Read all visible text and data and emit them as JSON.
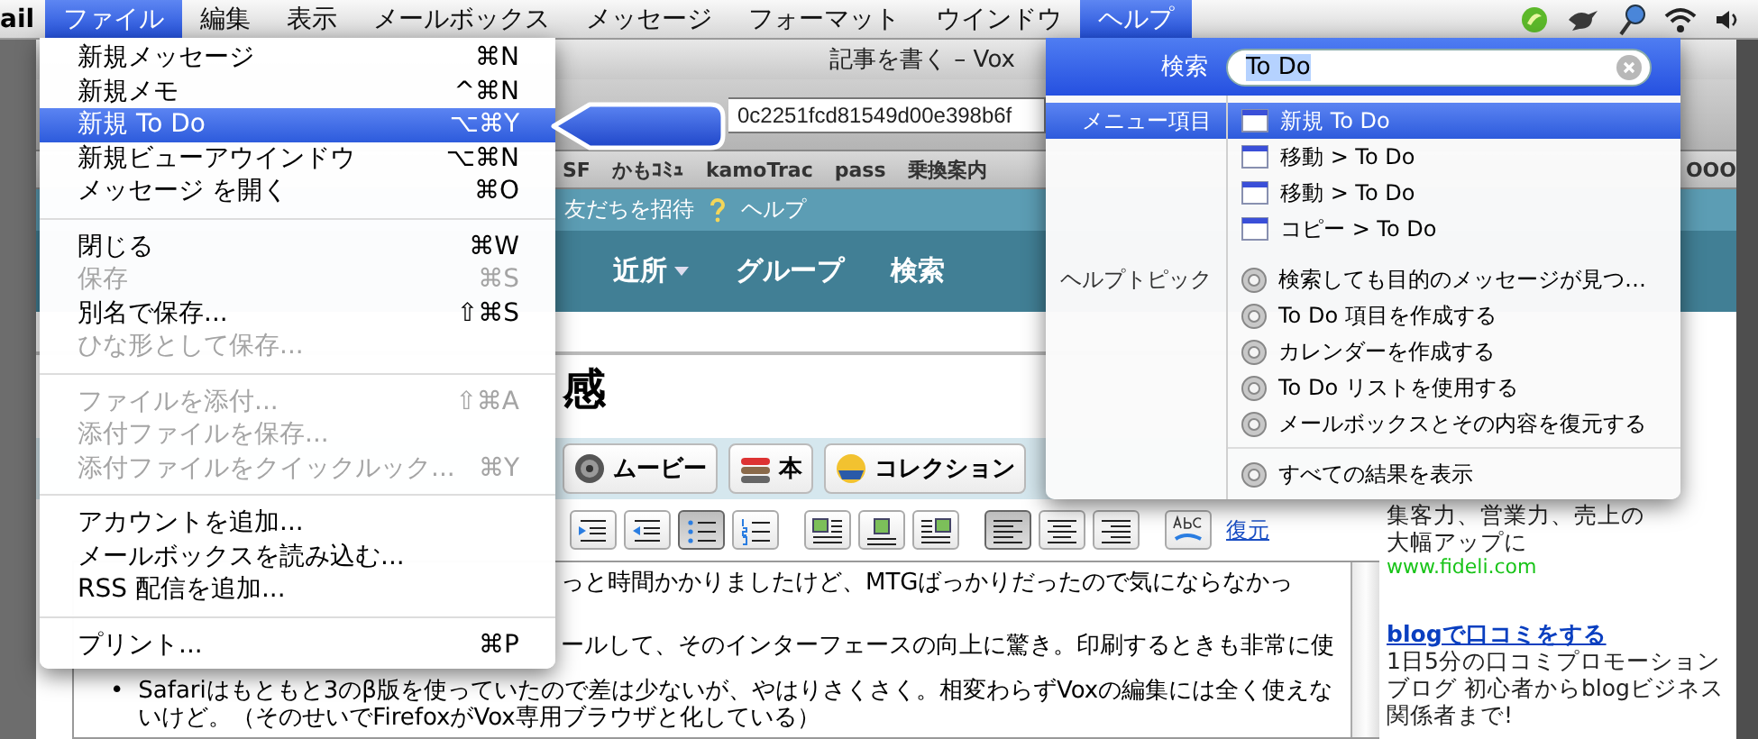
{
  "menubar": {
    "app_name": "ail",
    "menus": [
      {
        "label": "ファイル",
        "selected": true
      },
      {
        "label": "編集",
        "selected": false
      },
      {
        "label": "表示",
        "selected": false
      },
      {
        "label": "メールボックス",
        "selected": false
      },
      {
        "label": "メッセージ",
        "selected": false
      },
      {
        "label": "フォーマット",
        "selected": false
      },
      {
        "label": "ウインドウ",
        "selected": false
      },
      {
        "label": "ヘルプ",
        "selected": true
      }
    ]
  },
  "browser": {
    "title": "記事を書く – Vox",
    "url": "0c2251fcd81549d00e398b6f",
    "bookmarks": [
      "SF",
      "かもｺﾐｭ",
      "kamoTrac",
      "pass",
      "乗換案内"
    ],
    "bookmarks_right": "OOO",
    "site_links": [
      "友だちを招待",
      "ヘルプ"
    ],
    "nav": [
      {
        "label": "近所",
        "dropdown": true
      },
      {
        "label": "グループ",
        "dropdown": false
      },
      {
        "label": "検索",
        "dropdown": false
      }
    ],
    "post_title": "感",
    "insert_buttons": [
      {
        "kind": "movie",
        "label": "ムービー"
      },
      {
        "kind": "book",
        "label": "本"
      },
      {
        "kind": "collection",
        "label": "コレクション"
      }
    ],
    "format_tools": [
      {
        "kind": "indent",
        "on": false
      },
      {
        "kind": "outdent",
        "on": false
      },
      {
        "kind": "bullets",
        "on": true
      },
      {
        "kind": "numbers",
        "on": false
      },
      {
        "kind": "image_left",
        "on": false
      },
      {
        "kind": "image_center",
        "on": false
      },
      {
        "kind": "image_right",
        "on": false
      },
      {
        "kind": "align_left",
        "on": true
      },
      {
        "kind": "align_center",
        "on": false
      },
      {
        "kind": "align_right",
        "on": false
      },
      {
        "kind": "spellcheck"
      }
    ],
    "restore_link": "復元",
    "body": [
      {
        "kind": "paragraph",
        "text": "っと時間かかりましたけど、MTGばっかりだったので気にならなかっ"
      },
      {
        "kind": "paragraph",
        "text": "ールして、そのインターフェースの向上に驚き。印刷するときも非常に使"
      },
      {
        "kind": "bullet",
        "marker": "•",
        "text": "Safariはもともと3のβ版を使っていたので差は少ないが、やはりさくさく。相変わらずVoxの編集には全く使えないけど。（そのせいでFirefoxがVox専用ブラウザと化している）"
      }
    ],
    "sidebar": {
      "ad_lines": [
        "集客力、営業力、売上の",
        "大幅アップに"
      ],
      "ad_url": "www.fideli.com",
      "link": "blogで口コミをする",
      "text": "1日5分の口コミプロモーションブログ 初心者からblogビジネス関係者まで!"
    }
  },
  "file_menu": {
    "items": [
      {
        "kind": "item",
        "label": "新規メッセージ",
        "shortcut": "⌘N",
        "disabled": false,
        "selected": false
      },
      {
        "kind": "item",
        "label": "新規メモ",
        "shortcut": "^⌘N",
        "disabled": false,
        "selected": false
      },
      {
        "kind": "item",
        "label": "新規 To Do",
        "shortcut": "⌥⌘Y",
        "disabled": false,
        "selected": true
      },
      {
        "kind": "item",
        "label": "新規ビューアウインドウ",
        "shortcut": "⌥⌘N",
        "disabled": false,
        "selected": false
      },
      {
        "kind": "item",
        "label": "メッセージ を開く",
        "shortcut": "⌘O",
        "disabled": false,
        "selected": false
      },
      {
        "kind": "separator"
      },
      {
        "kind": "item",
        "label": "閉じる",
        "shortcut": "⌘W",
        "disabled": false,
        "selected": false
      },
      {
        "kind": "item",
        "label": "保存",
        "shortcut": "⌘S",
        "disabled": true,
        "selected": false
      },
      {
        "kind": "item",
        "label": "別名で保存...",
        "shortcut": "⇧⌘S",
        "disabled": false,
        "selected": false
      },
      {
        "kind": "item",
        "label": "ひな形として保存...",
        "disabled": true,
        "selected": false
      },
      {
        "kind": "separator"
      },
      {
        "kind": "item",
        "label": "ファイルを添付...",
        "shortcut": "⇧⌘A",
        "disabled": true,
        "selected": false
      },
      {
        "kind": "item",
        "label": "添付ファイルを保存...",
        "disabled": true,
        "selected": false
      },
      {
        "kind": "item",
        "label": "添付ファイルをクイックルック...",
        "shortcut": "⌘Y",
        "disabled": true,
        "selected": false
      },
      {
        "kind": "separator"
      },
      {
        "kind": "item",
        "label": "アカウントを追加...",
        "disabled": false,
        "selected": false
      },
      {
        "kind": "item",
        "label": "メールボックスを読み込む...",
        "disabled": false,
        "selected": false
      },
      {
        "kind": "item",
        "label": "RSS 配信を追加...",
        "disabled": false,
        "selected": false
      },
      {
        "kind": "separator"
      },
      {
        "kind": "item",
        "label": "プリント...",
        "shortcut": "⌘P",
        "disabled": false,
        "selected": false
      }
    ]
  },
  "help_menu": {
    "search_label": "検索",
    "query": "To Do",
    "sections": [
      {
        "label": "メニュー項目",
        "kind": "menu",
        "results": [
          {
            "label": "新規 To Do",
            "selected": true
          },
          {
            "label": "移動 > To Do",
            "selected": false
          },
          {
            "label": "移動 > To Do",
            "selected": false
          },
          {
            "label": "コピー > To Do",
            "selected": false
          }
        ]
      },
      {
        "label": "ヘルプトピック",
        "kind": "topic",
        "results": [
          {
            "label": "検索しても目的のメッセージが見つ…",
            "selected": false
          },
          {
            "label": "To Do 項目を作成する",
            "selected": false
          },
          {
            "label": "カレンダーを作成する",
            "selected": false
          },
          {
            "label": "To Do リストを使用する",
            "selected": false
          },
          {
            "label": "メールボックスとその内容を復元する",
            "selected": false
          }
        ]
      }
    ],
    "show_all": "すべての結果を表示"
  }
}
